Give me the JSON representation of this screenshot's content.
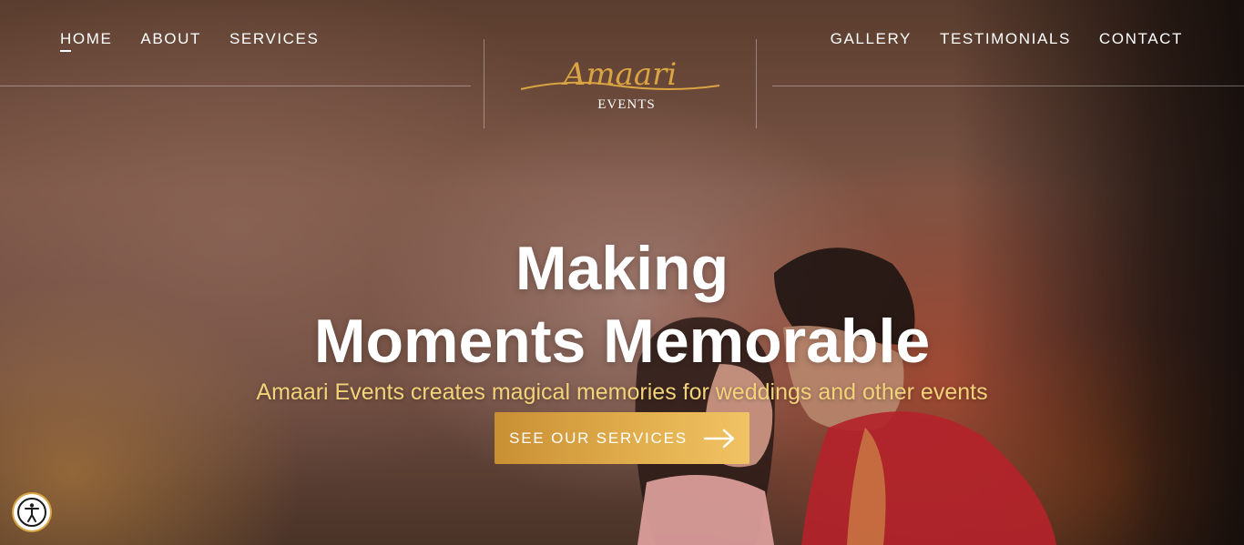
{
  "nav": {
    "left": [
      {
        "label": "HOME",
        "active": true
      },
      {
        "label": "ABOUT"
      },
      {
        "label": "SERVICES"
      }
    ],
    "right": [
      {
        "label": "GALLERY"
      },
      {
        "label": "TESTIMONIALS"
      },
      {
        "label": "CONTACT"
      }
    ]
  },
  "logo": {
    "script": "Amaari",
    "sub": "EVENTS"
  },
  "hero": {
    "title_line1": "Making",
    "title_line2": "Moments Memorable",
    "subtitle": "Amaari Events creates magical memories for weddings and other events",
    "cta_label": "SEE OUR SERVICES",
    "cta_icon": "arrow-right-icon"
  },
  "accessibility": {
    "icon": "accessibility-icon"
  },
  "colors": {
    "accent_gold": "#d9a441",
    "subtitle_gold": "#f3d27a",
    "white": "#ffffff"
  }
}
